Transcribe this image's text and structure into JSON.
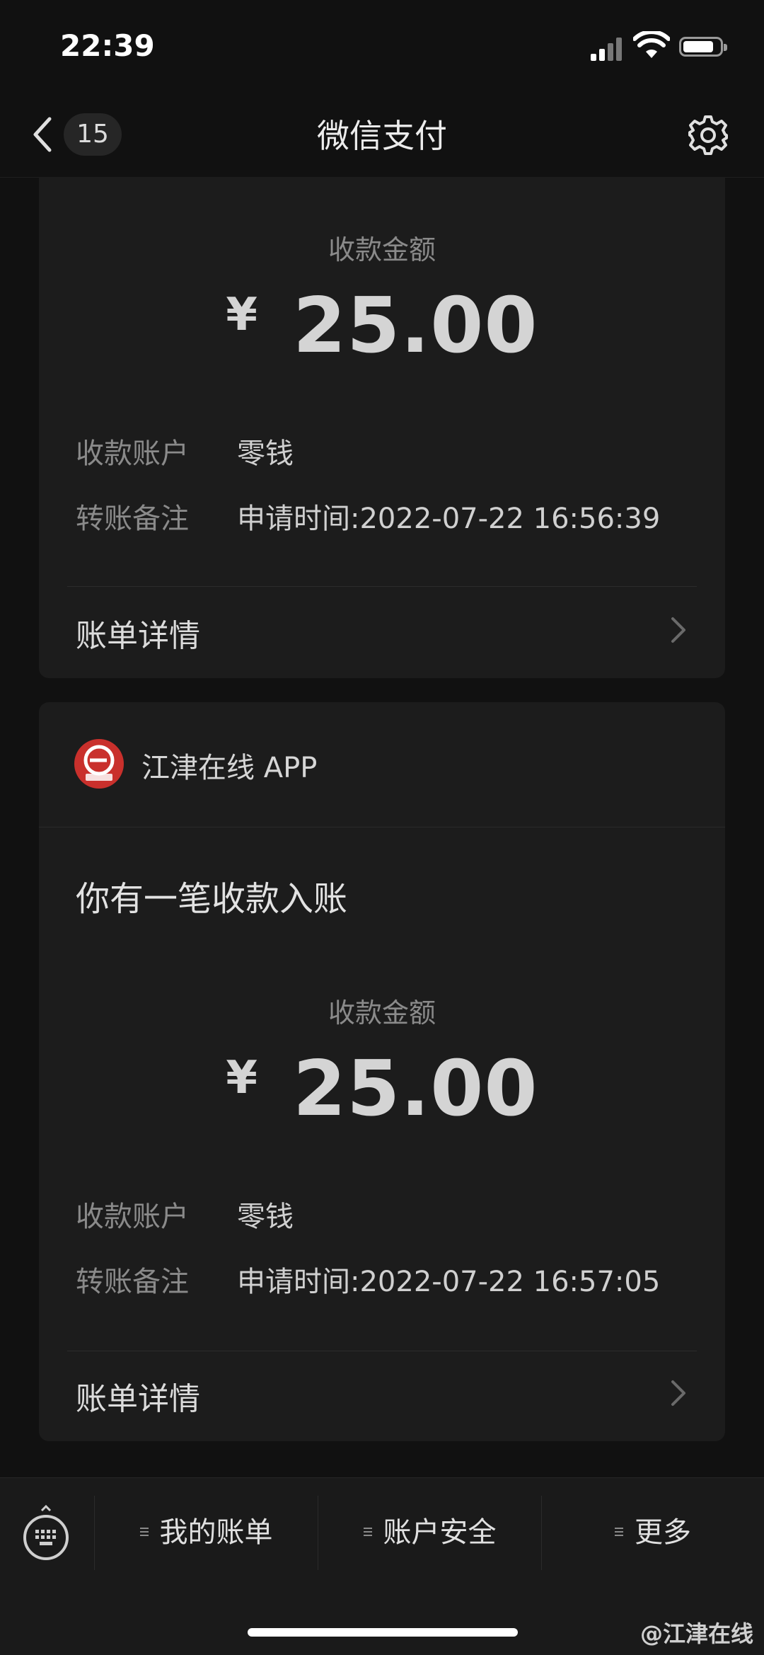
{
  "status_bar": {
    "time": "22:39"
  },
  "nav": {
    "back_count": "15",
    "title": "微信支付"
  },
  "cards": [
    {
      "amount_label": "收款金额",
      "currency": "¥",
      "amount": "25.00",
      "account_label": "收款账户",
      "account_value": "零钱",
      "note_label": "转账备注",
      "note_value": "申请时间:2022-07-22 16:56:39",
      "detail_label": "账单详情"
    },
    {
      "app_name": "江津在线 APP",
      "headline": "你有一笔收款入账",
      "amount_label": "收款金额",
      "currency": "¥",
      "amount": "25.00",
      "account_label": "收款账户",
      "account_value": "零钱",
      "note_label": "转账备注",
      "note_value": "申请时间:2022-07-22 16:57:05",
      "detail_label": "账单详情"
    }
  ],
  "tabbar": {
    "items": [
      {
        "label": "我的账单"
      },
      {
        "label": "账户安全"
      },
      {
        "label": "更多"
      }
    ]
  },
  "watermark": "@江津在线",
  "icons": {
    "back": "chevron-left-icon",
    "settings": "gear-icon",
    "keyboard": "keyboard-icon",
    "detail_arrow": "chevron-right-icon",
    "app_logo": "jiangjin-online-logo"
  },
  "colors": {
    "background": "#111111",
    "card": "#1c1c1c",
    "logo_red": "#c9302c",
    "muted_text": "#8a8a8a"
  }
}
